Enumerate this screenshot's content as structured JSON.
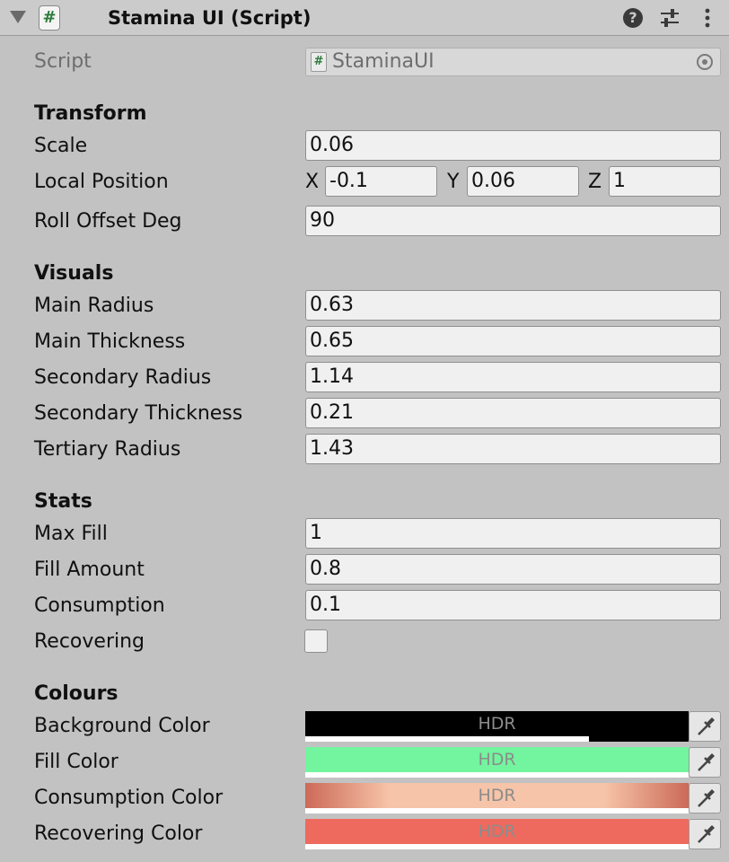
{
  "header": {
    "title": "Stamina UI (Script)",
    "script_icon": "#",
    "help_icon": "?"
  },
  "script": {
    "label": "Script",
    "value": "StaminaUI",
    "mini_icon": "#"
  },
  "transform": {
    "heading": "Transform",
    "scale_label": "Scale",
    "scale_value": "0.06",
    "local_position_label": "Local Position",
    "x_label": "X",
    "x_value": "-0.1",
    "y_label": "Y",
    "y_value": "0.06",
    "z_label": "Z",
    "z_value": "1",
    "roll_label": "Roll Offset Deg",
    "roll_value": "90"
  },
  "visuals": {
    "heading": "Visuals",
    "fields": [
      {
        "label": "Main Radius",
        "value": "0.63"
      },
      {
        "label": "Main Thickness",
        "value": "0.65"
      },
      {
        "label": "Secondary Radius",
        "value": "1.14"
      },
      {
        "label": "Secondary Thickness",
        "value": "0.21"
      },
      {
        "label": "Tertiary Radius",
        "value": "1.43"
      }
    ]
  },
  "stats": {
    "heading": "Stats",
    "fields": [
      {
        "label": "Max Fill",
        "value": "1"
      },
      {
        "label": "Fill Amount",
        "value": "0.8"
      },
      {
        "label": "Consumption",
        "value": "0.1"
      }
    ],
    "recovering_label": "Recovering",
    "recovering_checked": false
  },
  "colours": {
    "heading": "Colours",
    "hdr_label": "HDR",
    "items": [
      {
        "label": "Background Color",
        "color": "#000000",
        "alpha": 0.74
      },
      {
        "label": "Fill Color",
        "color": "#72f59e",
        "alpha": 1.0
      },
      {
        "label": "Consumption Color",
        "color": "#f6c4a8",
        "alpha": 1.0
      },
      {
        "label": "Recovering Color",
        "color": "#ee6a5e",
        "alpha": 1.0
      }
    ]
  },
  "icons": {
    "foldout": "triangle-down-icon",
    "presets": "sliders-icon",
    "menu": "kebab-menu-icon",
    "picker": "object-picker-icon",
    "eyedropper": "eyedropper-icon"
  }
}
